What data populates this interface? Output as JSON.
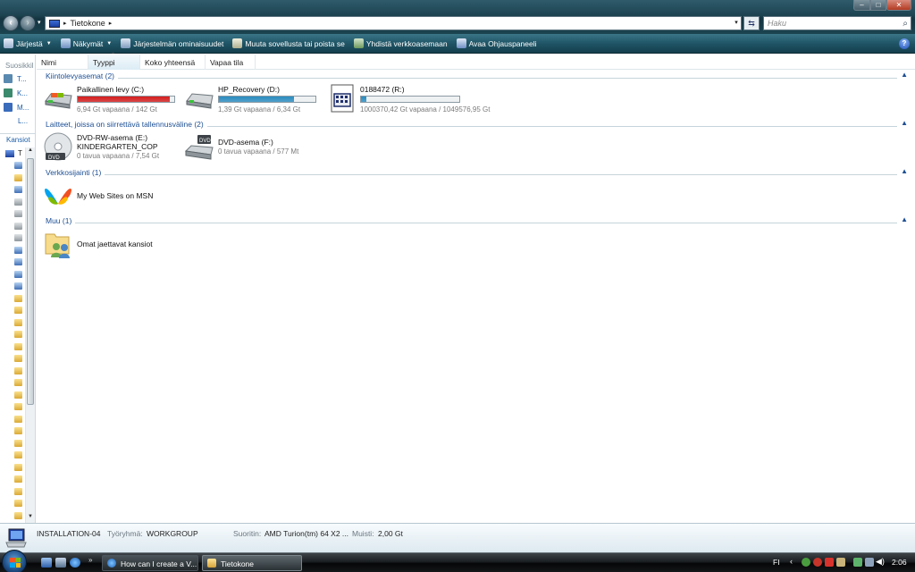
{
  "window": {
    "controls": {
      "minimize": "–",
      "maximize": "□",
      "close": "✕"
    }
  },
  "address": {
    "text": "Tietokone",
    "search_placeholder": "Haku"
  },
  "toolbar": {
    "organize": "Järjestä",
    "views": "Näkymät",
    "system_properties": "Järjestelmän ominaisuudet",
    "uninstall": "Muuta sovellusta tai poista se",
    "map_drive": "Yhdistä verkkoasemaan",
    "control_panel": "Avaa Ohjauspaneeli",
    "help": "?"
  },
  "navpane": {
    "favorites_header": "Suosikkil",
    "favorites": [
      "T...",
      "K...",
      "M...",
      "L..."
    ],
    "folders_header": "Kansiot",
    "tree_root": "T"
  },
  "columns": [
    "Nimi",
    "Tyyppi",
    "Koko yhteensä",
    "Vapaa tila"
  ],
  "groups": [
    {
      "title": "Kiintolevyasemat (2)",
      "items": [
        {
          "name": "Paikallinen levy (C:)",
          "detail": "6,94 Gt vapaana / 142 Gt",
          "used_fraction": 0.95,
          "bar_color": "#d41d1d"
        },
        {
          "name": "HP_Recovery (D:)",
          "detail": "1,39 Gt vapaana / 6,34 Gt",
          "used_fraction": 0.78,
          "bar_color": "#2a8cc0"
        },
        {
          "name": "0188472 (R:)",
          "detail": "1000370,42 Gt vapaana / 1049576,95 Gt",
          "used_fraction": 0.05,
          "bar_color": "#2a8cc0"
        }
      ]
    },
    {
      "title": "Laitteet, joissa on siirrettävä tallennusväline (2)",
      "items": [
        {
          "name": "DVD-RW-asema (E:)",
          "name2": "KINDERGARTEN_COP",
          "detail": "0 tavua vapaana / 7,54 Gt"
        },
        {
          "name": "DVD-asema (F:)",
          "detail": "0 tavua vapaana / 577 Mt"
        }
      ]
    },
    {
      "title": "Verkkosijainti (1)",
      "items": [
        {
          "name": "My Web Sites on MSN"
        }
      ]
    },
    {
      "title": "Muu (1)",
      "items": [
        {
          "name": "Omat jaettavat kansiot"
        }
      ]
    }
  ],
  "details": {
    "computer_name": "INSTALLATION-04",
    "workgroup_label": "Työryhmä:",
    "workgroup": "WORKGROUP",
    "processor_label": "Suoritin:",
    "processor": "AMD Turion(tm) 64 X2 ...",
    "memory_label": "Muisti:",
    "memory": "2,00 Gt"
  },
  "taskbar": {
    "tasks": [
      "How can I create a V...",
      "Tietokone"
    ],
    "language": "FI",
    "clock": "2:06"
  }
}
